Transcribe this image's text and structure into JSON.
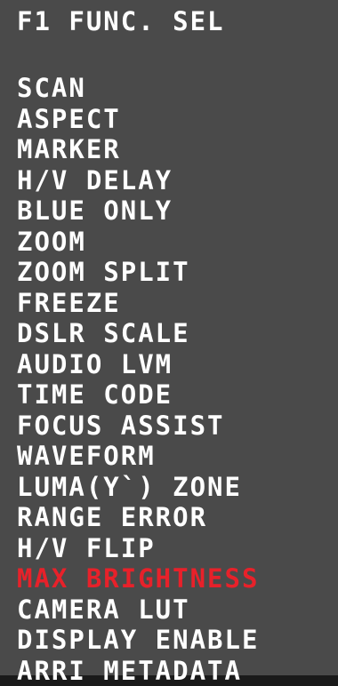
{
  "title": "F1 FUNC. SEL",
  "selected_color": "#e8212a",
  "text_color": "#ffffff",
  "background_color": "#4a4a4a",
  "menu": {
    "items": [
      {
        "label": "SCAN",
        "selected": false
      },
      {
        "label": "ASPECT",
        "selected": false
      },
      {
        "label": "MARKER",
        "selected": false
      },
      {
        "label": "H/V DELAY",
        "selected": false
      },
      {
        "label": "BLUE ONLY",
        "selected": false
      },
      {
        "label": "ZOOM",
        "selected": false
      },
      {
        "label": "ZOOM SPLIT",
        "selected": false
      },
      {
        "label": "FREEZE",
        "selected": false
      },
      {
        "label": "DSLR SCALE",
        "selected": false
      },
      {
        "label": "AUDIO LVM",
        "selected": false
      },
      {
        "label": "TIME CODE",
        "selected": false
      },
      {
        "label": "FOCUS ASSIST",
        "selected": false
      },
      {
        "label": "WAVEFORM",
        "selected": false
      },
      {
        "label": "LUMA(Y`) ZONE",
        "selected": false
      },
      {
        "label": "RANGE ERROR",
        "selected": false
      },
      {
        "label": "H/V FLIP",
        "selected": false
      },
      {
        "label": "MAX BRIGHTNESS",
        "selected": true
      },
      {
        "label": "CAMERA LUT",
        "selected": false
      },
      {
        "label": "DISPLAY ENABLE",
        "selected": false
      },
      {
        "label": "ARRI METADATA",
        "selected": false
      }
    ]
  }
}
